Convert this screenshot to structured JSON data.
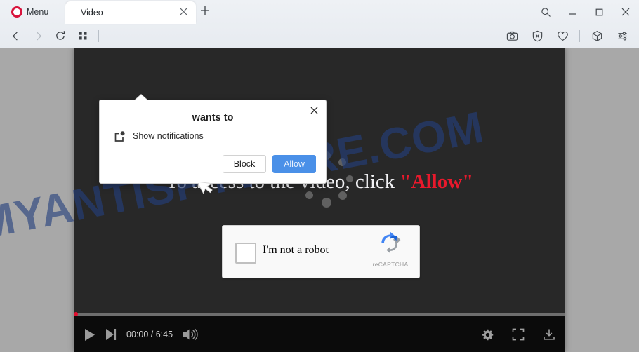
{
  "browser": {
    "name": "Opera",
    "menu_label": "Menu",
    "tabs": [
      {
        "title": "Video",
        "close_icon": "close-icon",
        "active": true
      }
    ],
    "new_tab_icon": "plus-icon",
    "window_controls": [
      {
        "name": "search-icon",
        "glyph": "search"
      },
      {
        "name": "minimize-icon",
        "glyph": "minimize"
      },
      {
        "name": "maximize-icon",
        "glyph": "maximize"
      },
      {
        "name": "close-window-icon",
        "glyph": "close"
      }
    ],
    "nav_buttons": [
      {
        "name": "back-icon",
        "enabled": true
      },
      {
        "name": "forward-icon",
        "enabled": false
      },
      {
        "name": "reload-icon",
        "enabled": true
      },
      {
        "name": "speed-dial-icon",
        "enabled": true
      }
    ],
    "toolbar_right_icons": [
      {
        "name": "snapshot-camera-icon"
      },
      {
        "name": "shield-blocker-icon"
      },
      {
        "name": "heart-icon"
      },
      {
        "name": "cube-icon"
      },
      {
        "name": "settings-sliders-icon"
      }
    ]
  },
  "page": {
    "watermark": "MYANTISPYWARE.COM",
    "watermark_color": "#24407e",
    "background_color": "#a8a8a8",
    "video_background_color": "#282828"
  },
  "video": {
    "message_prefix": "To access to the video, click ",
    "message_highlight": "\"Allow\"",
    "highlight_color": "#e8192c",
    "spinner_name": "loading-spinner"
  },
  "captcha": {
    "label": "I'm not a robot",
    "brand": "reCAPTCHA",
    "checkbox_checked": false
  },
  "player": {
    "play_icon": "play-icon",
    "next_icon": "next-track-icon",
    "time_display": "00:00 / 6:45",
    "current_time": "00:00",
    "duration": "6:45",
    "volume_icon": "volume-icon",
    "settings_icon": "gear-icon",
    "fullscreen_icon": "fullscreen-icon",
    "download_icon": "download-icon",
    "progress_percent": 0,
    "progress_color": "#e10d2e"
  },
  "notification_dialog": {
    "title": "wants to",
    "permission_label": "Show notifications",
    "permission_icon": "notification-bell-icon",
    "block_label": "Block",
    "allow_label": "Allow",
    "allow_color": "#4a90e8",
    "close_icon": "close-icon"
  }
}
